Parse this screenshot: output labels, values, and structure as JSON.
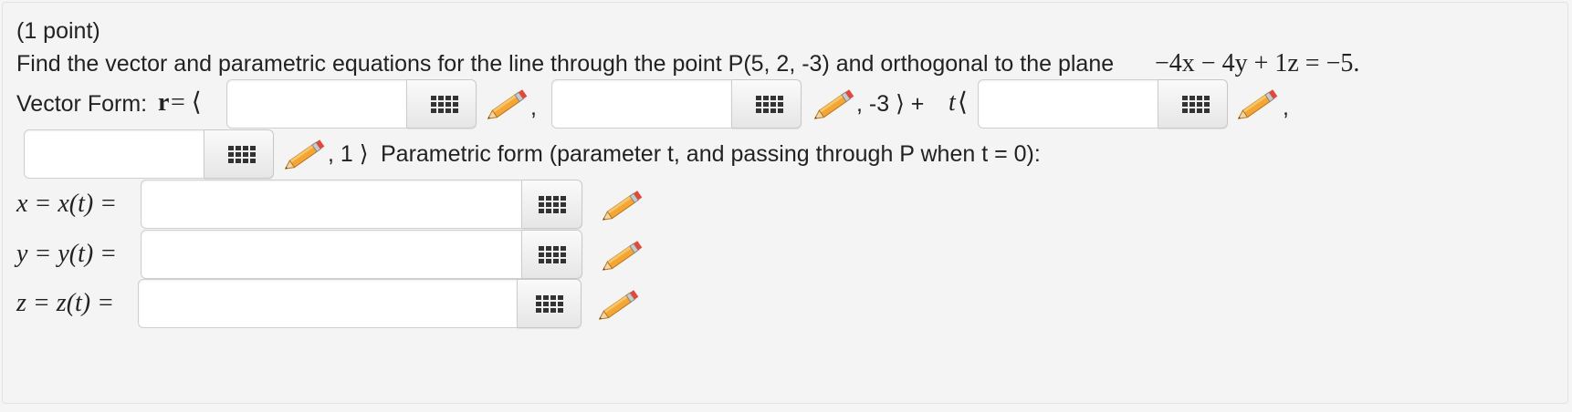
{
  "problem": {
    "points": "(1 point)",
    "prompt": "Find the vector and parametric equations for the line through the point P(5, 2, -3) and orthogonal to the plane",
    "plane_equation": "−4x − 4y + 1z = −5.",
    "vector_form_label": "Vector Form:",
    "r_symbol": "r",
    "equals_angle": " = ⟨",
    "separator_comma": ",",
    "fixed_z_point": ", -3 ⟩ +",
    "t_symbol": "t",
    "open_angle": "⟨",
    "fixed_direction_z": ", 1 ⟩",
    "parametric_text": "Parametric form (parameter t, and passing through P when t = 0):",
    "x_label": "x = x(t) =",
    "y_label": "y = y(t) =",
    "z_label": "z = z(t) ="
  },
  "answers": {
    "point_x": "",
    "point_y": "",
    "direction_x": "",
    "direction_y": "",
    "param_x": "",
    "param_y": "",
    "param_z": ""
  },
  "icons": {
    "keyboard": "keypad-grid-icon",
    "pencil": "pencil-edit-icon"
  },
  "colors": {
    "pencil_body": "#f3a633",
    "pencil_tip": "#e04a3a"
  }
}
